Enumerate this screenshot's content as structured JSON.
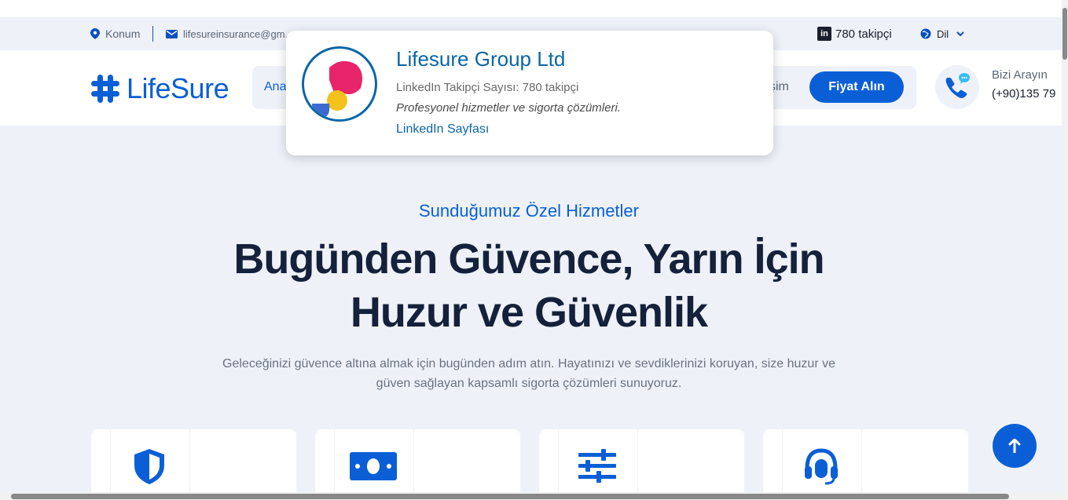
{
  "topbar": {
    "location": "Konum",
    "email": "lifesureinsurance@gm...",
    "followers": "780 takipçi",
    "linkedin_letters": "in",
    "language": "Dil"
  },
  "header": {
    "logo_text": "LifeSure",
    "nav_first_partial": "Ana",
    "nav_last_partial": "tişim",
    "quote_button": "Fiyat Alın",
    "call_label": "Bizi Arayın",
    "call_number": "(+90)135 79"
  },
  "popup": {
    "title": "Lifesure Group Ltd",
    "followers": "LinkedIn Takipçi Sayısı: 780 takipçi",
    "description": "Profesyonel hizmetler ve sigorta çözümleri.",
    "link": "LinkedIn Sayfası"
  },
  "hero": {
    "subtitle": "Sunduğumuz Özel Hizmetler",
    "title_line1": "Bugünden Güvence, Yarın İçin",
    "title_line2": "Huzur ve Güvenlik",
    "description": "Geleceğinizi güvence altına almak için bugünden adım atın. Hayatınızı ve sevdiklerinizi koruyan, size huzur ve güven sağlayan kapsamlı sigorta çözümleri sunuyoruz."
  },
  "cards": [
    {
      "icon": "shield-icon"
    },
    {
      "icon": "money-icon"
    },
    {
      "icon": "sliders-icon"
    },
    {
      "icon": "headset-icon"
    }
  ],
  "colors": {
    "primary": "#0b5fd6",
    "dark": "#15213b",
    "background": "#eef2f8",
    "linkedin": "#0a66a8"
  }
}
